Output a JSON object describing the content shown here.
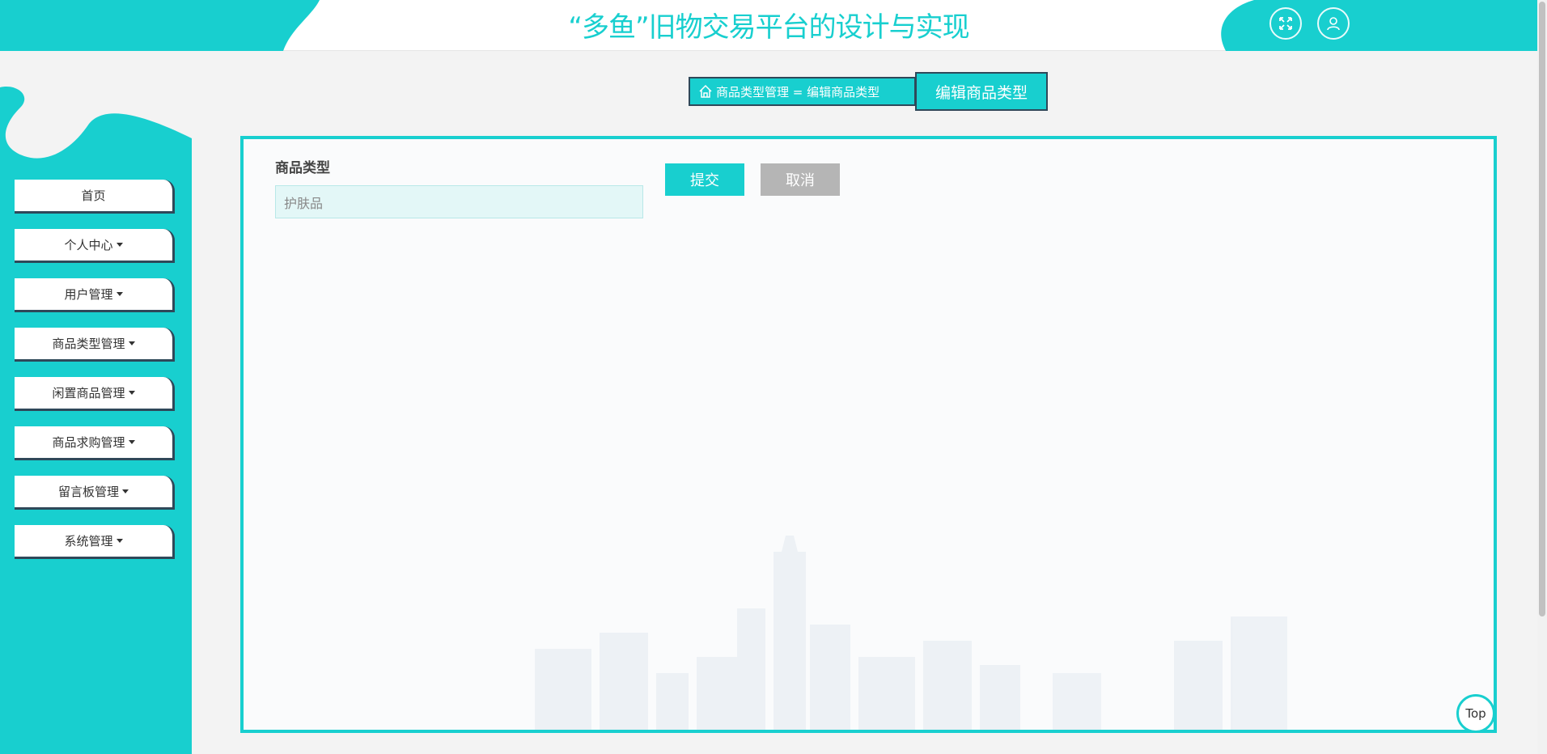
{
  "header": {
    "title": "“多鱼”旧物交易平台的设计与实现",
    "fullscreen_icon": "fullscreen-icon",
    "user_icon": "user-icon"
  },
  "sidebar": {
    "items": [
      {
        "label": "首页",
        "has_caret": false
      },
      {
        "label": "个人中心",
        "has_caret": true
      },
      {
        "label": "用户管理",
        "has_caret": true
      },
      {
        "label": "商品类型管理",
        "has_caret": true
      },
      {
        "label": "闲置商品管理",
        "has_caret": true
      },
      {
        "label": "商品求购管理",
        "has_caret": true
      },
      {
        "label": "留言板管理",
        "has_caret": true
      },
      {
        "label": "系统管理",
        "has_caret": true
      }
    ]
  },
  "breadcrumb": {
    "home_icon": "home-icon",
    "path": "商品类型管理 = 编辑商品类型",
    "current": "编辑商品类型"
  },
  "form": {
    "label": "商品类型",
    "value": "护肤品",
    "submit_label": "提交",
    "cancel_label": "取消"
  },
  "back_to_top": "Top",
  "colors": {
    "accent": "#18cfcf",
    "dark": "#2f4859",
    "cancel": "#b5b5b5"
  }
}
